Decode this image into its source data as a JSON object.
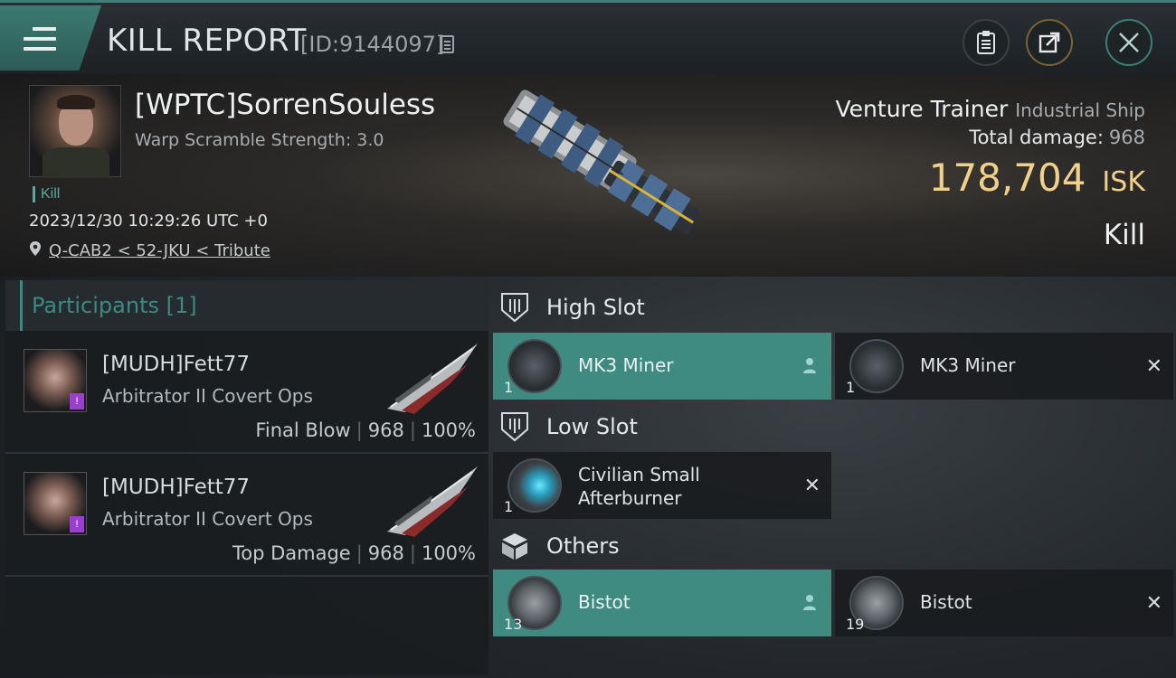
{
  "header": {
    "title": "KILL REPORT",
    "report_id": "[ID:9144097]"
  },
  "victim": {
    "name": "[WPTC]SorrenSouless",
    "warp_scramble": "Warp Scramble Strength: 3.0",
    "tag": "Kill",
    "datetime": "2023/12/30 10:29:26 UTC +0",
    "location": "Q-CAB2 < 52-JKU < Tribute"
  },
  "summary": {
    "ship_name": "Venture Trainer",
    "ship_class": "Industrial Ship",
    "total_damage_label": "Total damage:",
    "total_damage": "968",
    "isk_value": "178,704",
    "isk_unit": "ISK",
    "result": "Kill"
  },
  "participants": {
    "title": "Participants [1]",
    "rows": [
      {
        "name": "[MUDH]Fett77",
        "ship": "Arbitrator II Covert Ops",
        "role": "Final Blow",
        "damage": "968",
        "percent": "100%"
      },
      {
        "name": "[MUDH]Fett77",
        "ship": "Arbitrator II Covert Ops",
        "role": "Top Damage",
        "damage": "968",
        "percent": "100%"
      }
    ]
  },
  "slots": {
    "high": {
      "title": "High Slot",
      "items": [
        {
          "name": "MK3 Miner",
          "qty": "1",
          "status": "dropped"
        },
        {
          "name": "MK3 Miner",
          "qty": "1",
          "status": "destroyed"
        }
      ]
    },
    "low": {
      "title": "Low Slot",
      "items": [
        {
          "name_line1": "Civilian Small",
          "name_line2": "Afterburner",
          "qty": "1",
          "status": "destroyed"
        }
      ]
    },
    "others": {
      "title": "Others",
      "items": [
        {
          "name": "Bistot",
          "qty": "13",
          "status": "dropped"
        },
        {
          "name": "Bistot",
          "qty": "19",
          "status": "destroyed"
        }
      ]
    }
  },
  "colors": {
    "accent": "#3f8b82",
    "isk": "#f0d08a",
    "badge": "#9b3fd1"
  }
}
